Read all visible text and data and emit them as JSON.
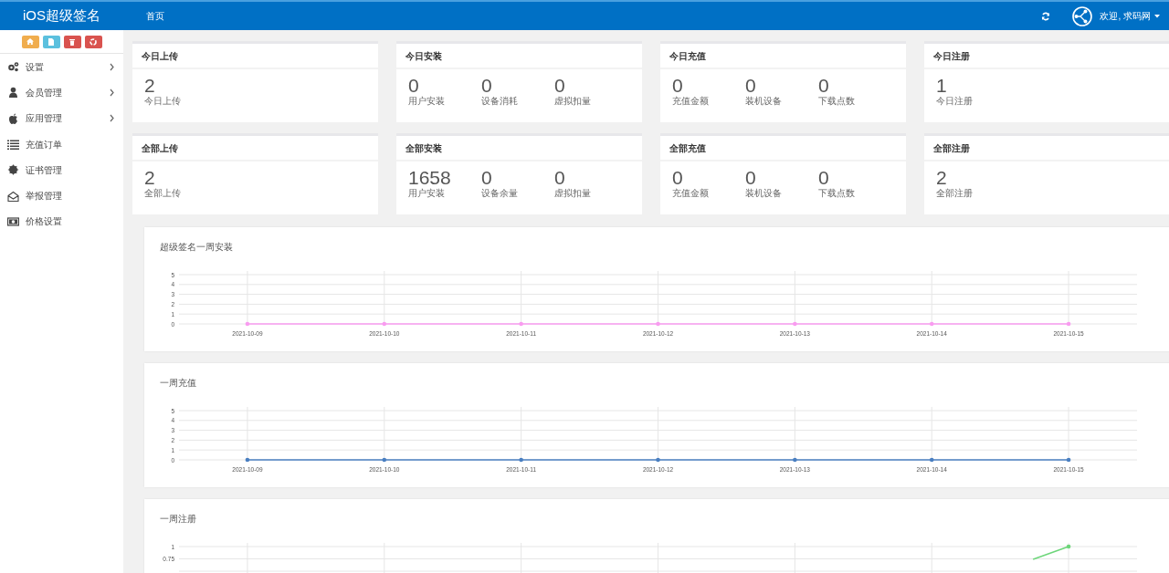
{
  "navbar": {
    "brand": "iOS超级签名",
    "links": [
      {
        "label": "首页"
      }
    ],
    "user": "欢迎, 求码网"
  },
  "sidebar": {
    "quick_buttons": [
      {
        "kind": "home",
        "color": "#f0ad4e"
      },
      {
        "kind": "file",
        "color": "#5bc0de"
      },
      {
        "kind": "trash",
        "color": "#d9534f"
      },
      {
        "kind": "recycle",
        "color": "#d9534f"
      }
    ],
    "items": [
      {
        "label": "设置",
        "kind": "gears",
        "expandable": true
      },
      {
        "label": "会员管理",
        "kind": "user",
        "expandable": true
      },
      {
        "label": "应用管理",
        "kind": "apple",
        "expandable": true
      },
      {
        "label": "充值订单",
        "kind": "list",
        "expandable": false
      },
      {
        "label": "证书管理",
        "kind": "certificate",
        "expandable": false
      },
      {
        "label": "举报管理",
        "kind": "envelope",
        "expandable": false
      },
      {
        "label": "价格设置",
        "kind": "money",
        "expandable": false
      }
    ]
  },
  "stat_rows": [
    [
      {
        "title": "今日上传",
        "stats": [
          {
            "value": "2",
            "label": "今日上传"
          }
        ]
      },
      {
        "title": "今日安装",
        "stats": [
          {
            "value": "0",
            "label": "用户安装"
          },
          {
            "value": "0",
            "label": "设备消耗"
          },
          {
            "value": "0",
            "label": "虚拟扣量"
          }
        ]
      },
      {
        "title": "今日充值",
        "stats": [
          {
            "value": "0",
            "label": "充值金额"
          },
          {
            "value": "0",
            "label": "装机设备"
          },
          {
            "value": "0",
            "label": "下载点数"
          }
        ]
      },
      {
        "title": "今日注册",
        "stats": [
          {
            "value": "1",
            "label": "今日注册"
          }
        ]
      }
    ],
    [
      {
        "title": "全部上传",
        "stats": [
          {
            "value": "2",
            "label": "全部上传"
          }
        ]
      },
      {
        "title": "全部安装",
        "stats": [
          {
            "value": "1658",
            "label": "用户安装"
          },
          {
            "value": "0",
            "label": "设备余量"
          },
          {
            "value": "0",
            "label": "虚拟扣量"
          }
        ]
      },
      {
        "title": "全部充值",
        "stats": [
          {
            "value": "0",
            "label": "充值金额"
          },
          {
            "value": "0",
            "label": "装机设备"
          },
          {
            "value": "0",
            "label": "下载点数"
          }
        ]
      },
      {
        "title": "全部注册",
        "stats": [
          {
            "value": "2",
            "label": "全部注册"
          }
        ]
      }
    ]
  ],
  "charts": [
    {
      "title": "超级签名一周安装",
      "chart_data": {
        "type": "line",
        "grid": true,
        "categories": [
          "2021-10-09",
          "2021-10-10",
          "2021-10-11",
          "2021-10-12",
          "2021-10-13",
          "2021-10-14",
          "2021-10-15"
        ],
        "ylim": [
          0,
          5
        ],
        "yticks": [
          0,
          1,
          2,
          3,
          4,
          5
        ],
        "series": [
          {
            "color": "#f99cf0",
            "values": [
              0,
              0,
              0,
              0,
              0,
              0,
              0
            ]
          }
        ]
      }
    },
    {
      "title": "一周充值",
      "chart_data": {
        "type": "line",
        "grid": true,
        "categories": [
          "2021-10-09",
          "2021-10-10",
          "2021-10-11",
          "2021-10-12",
          "2021-10-13",
          "2021-10-14",
          "2021-10-15"
        ],
        "ylim": [
          0,
          5
        ],
        "yticks": [
          0,
          1,
          2,
          3,
          4,
          5
        ],
        "series": [
          {
            "color": "#4a7fc1",
            "values": [
              0,
              0,
              0,
              0,
              0,
              0,
              0
            ]
          }
        ]
      }
    },
    {
      "title": "一周注册",
      "y_labels": [
        "1",
        "0.75"
      ]
    }
  ]
}
